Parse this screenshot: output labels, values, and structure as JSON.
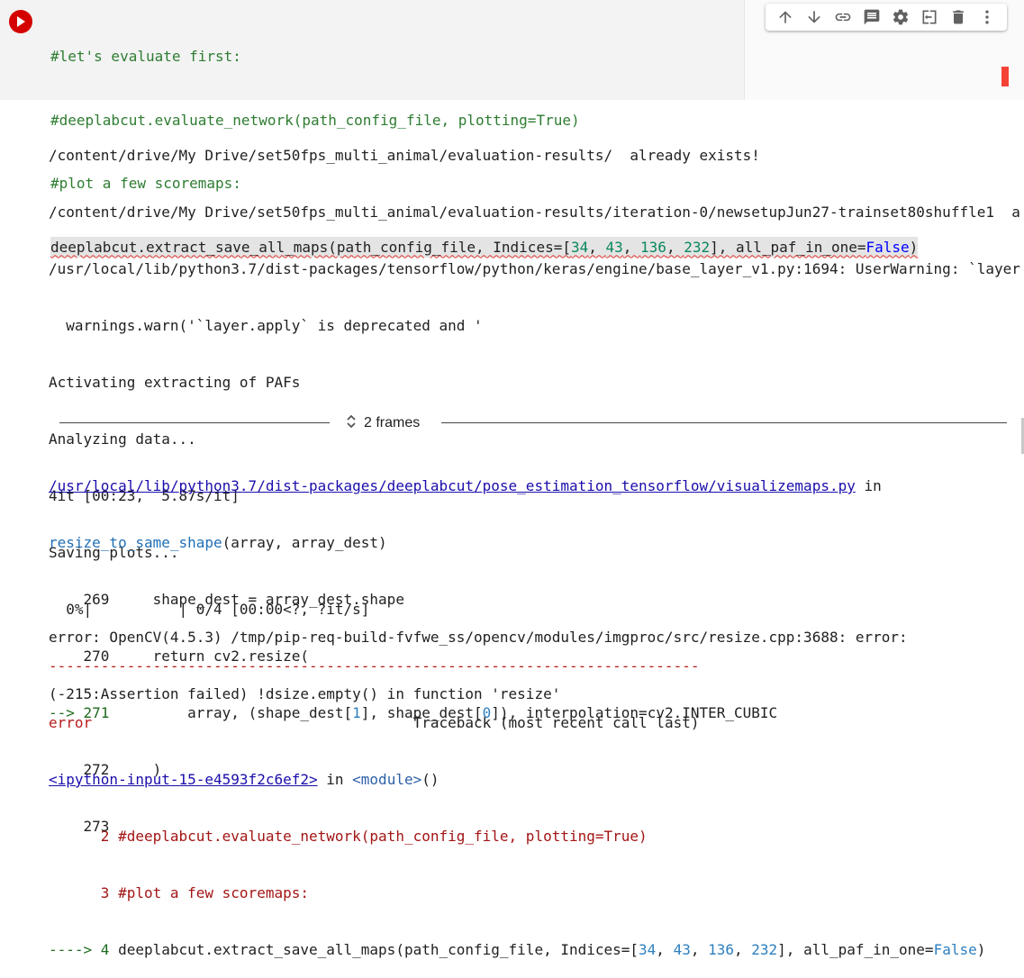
{
  "cell": {
    "code_lines": [
      "#let's evaluate first:",
      "#deeplabcut.evaluate_network(path_config_file, plotting=True)",
      "#plot a few scoremaps:"
    ],
    "code_call_prefix": "deeplabcut.extract_save_all_maps(path_config_file, Indices=[",
    "code_nums": [
      "34",
      "43",
      "136",
      "232"
    ],
    "code_sep": ", ",
    "code_mid": "], all_paf_in_one=",
    "code_bool": "False",
    "code_end": ")"
  },
  "toolbar": {
    "icons": [
      "arrow-up-icon",
      "arrow-down-icon",
      "link-icon",
      "comment-icon",
      "gear-icon",
      "mirror-cell-icon",
      "trash-icon",
      "more-vert-icon"
    ]
  },
  "output": {
    "lines": [
      "/content/drive/My Drive/set50fps_multi_animal/evaluation-results/  already exists!",
      "/content/drive/My Drive/set50fps_multi_animal/evaluation-results/iteration-0/newsetupJun27-trainset80shuffle1  a",
      "/usr/local/lib/python3.7/dist-packages/tensorflow/python/keras/engine/base_layer_v1.py:1694: UserWarning: `layer",
      "  warnings.warn('`layer.apply` is deprecated and '",
      "Activating extracting of PAFs",
      "Analyzing data...",
      "4it [00:23,  5.87s/it]",
      "Saving plots...",
      "  0%|          | 0/4 [00:00<?, ?it/s]"
    ],
    "dash_line": "---------------------------------------------------------------------------",
    "error_label": "error",
    "traceback_label": "                                     Traceback (most recent call last)",
    "input_link": "<ipython-input-15-e4593f2c6ef2>",
    "in_text": " in ",
    "module_text": "<module>",
    "module_paren": "()",
    "tb_line2": "      2 #deeplabcut.evaluate_network(path_config_file, plotting=True)",
    "tb_line3": "      3 #plot a few scoremaps:",
    "tb_arrow4": "----> 4 ",
    "tb_call_prefix": "deeplabcut.extract_save_all_maps(path_config_file, Indices=[",
    "tb_mid": "], all_paf_in_one=",
    "tb_bool": "False",
    "tb_end": ")",
    "frames_label": "2 frames",
    "file_link": "/usr/local/lib/python3.7/dist-packages/deeplabcut/pose_estimation_tensorflow/visualizemaps.py",
    "file_in": " in",
    "func_name": "resize_to_same_shape",
    "func_args": "(array, array_dest)",
    "l269": "    269     shape_dest = array_dest.shape",
    "l270": "    270     return cv2.resize(",
    "l271_arrow": "--> 271",
    "l271_a": "         array, (shape_dest[",
    "l271_n1": "1",
    "l271_b": "], shape_dest[",
    "l271_n0": "0",
    "l271_c": "]), interpolation=cv2.INTER_CUBIC",
    "l272": "    272     )",
    "l273": "    273",
    "final_error_1": "error: OpenCV(4.5.3) /tmp/pip-req-build-fvfwe_ss/opencv/modules/imgproc/src/resize.cpp:3688: error:",
    "final_error_2": "(-215:Assertion failed) !dsize.empty() in function 'resize'"
  },
  "colors": {
    "run_button": "#d50000",
    "comment": "#2e7d32",
    "error": "#b71c1c",
    "link": "#1a0dab"
  }
}
